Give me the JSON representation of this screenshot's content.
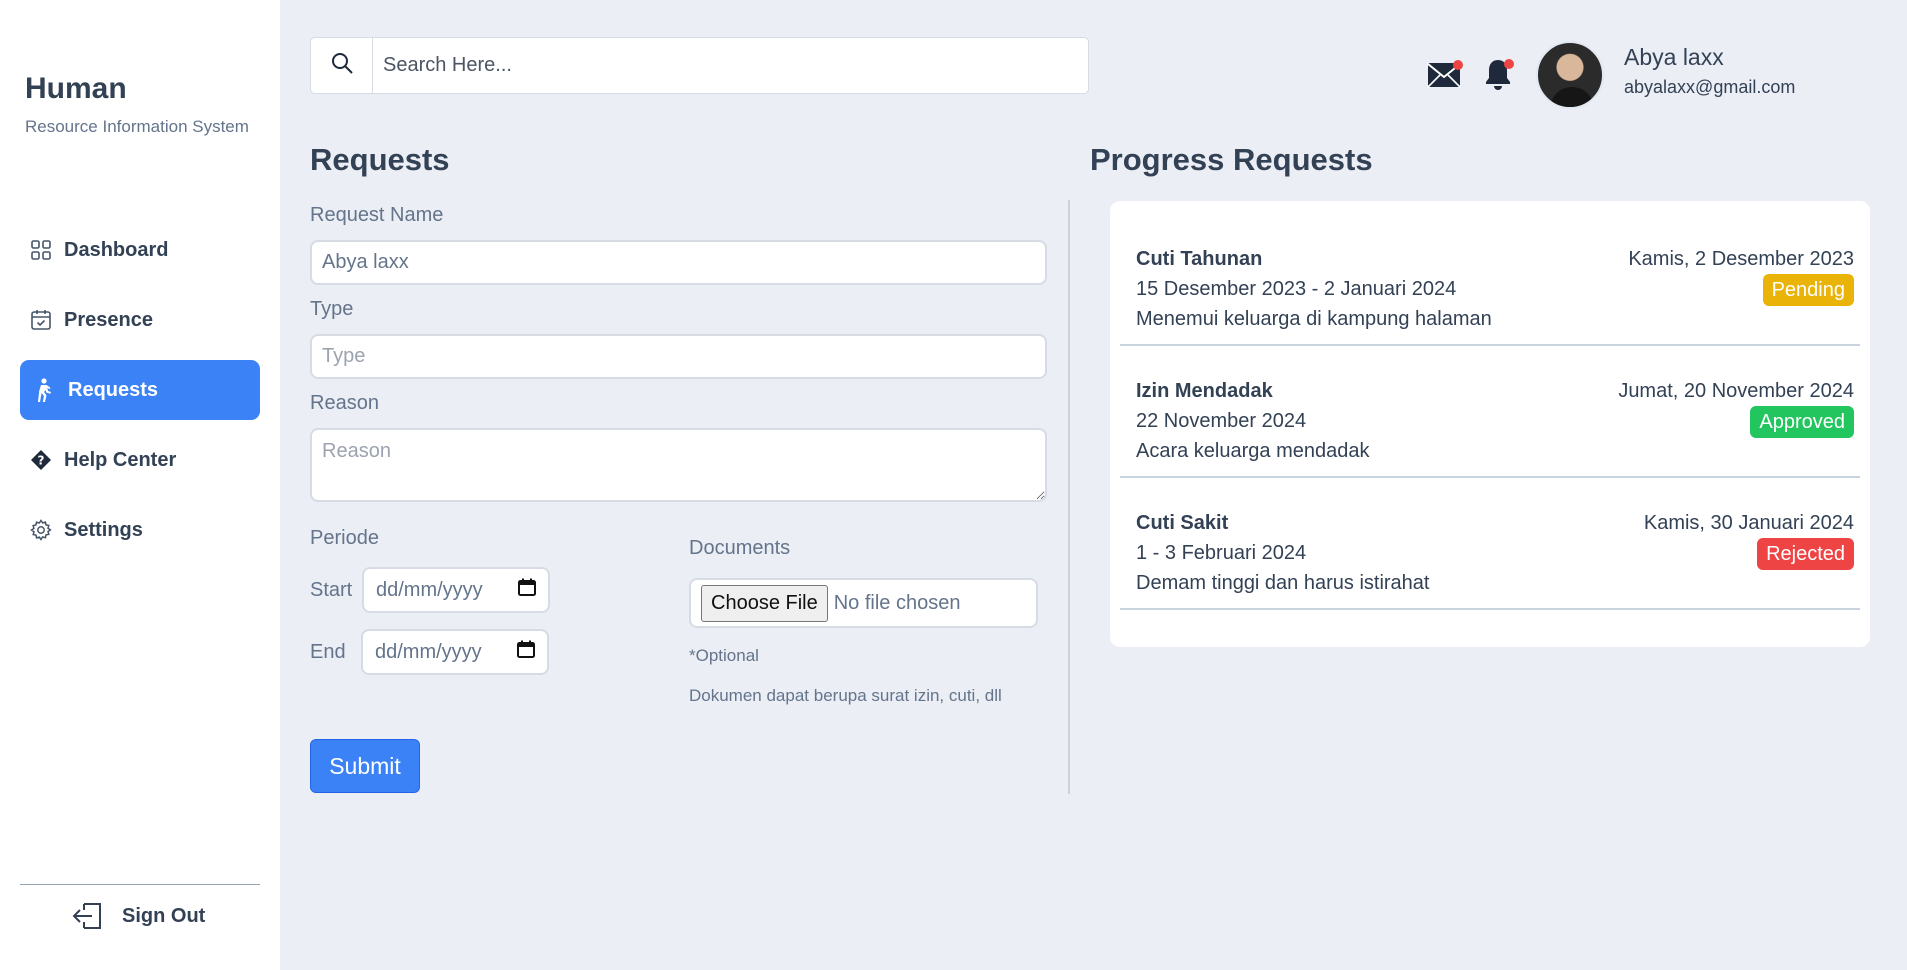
{
  "brand": {
    "title": "Human",
    "subtitle": "Resource Information System"
  },
  "sidebar": {
    "items": [
      {
        "label": "Dashboard",
        "icon": "grid-icon"
      },
      {
        "label": "Presence",
        "icon": "calendar-check-icon"
      },
      {
        "label": "Requests",
        "icon": "person-walking-icon",
        "active": true
      },
      {
        "label": "Help Center",
        "icon": "question-diamond-icon"
      },
      {
        "label": "Settings",
        "icon": "gear-icon"
      }
    ],
    "signout_label": "Sign Out"
  },
  "search": {
    "placeholder": "Search Here..."
  },
  "user": {
    "name": "Abya laxx",
    "email": "abyalaxx@gmail.com"
  },
  "colors": {
    "accent": "#3b82f6",
    "pending": "#eab308",
    "approved": "#22c55e",
    "rejected": "#ef4444",
    "background": "#ebeef5"
  },
  "requests_form": {
    "title": "Requests",
    "request_name_label": "Request Name",
    "request_name_value": "Abya laxx",
    "type_label": "Type",
    "type_placeholder": "Type",
    "reason_label": "Reason",
    "reason_placeholder": "Reason",
    "periode_label": "Periode",
    "start_label": "Start",
    "end_label": "End",
    "date_placeholder": "dd/mm/yyyy",
    "documents_label": "Documents",
    "choose_file_label": "Choose File",
    "no_file_label": "No file chosen",
    "optional_note": "*Optional",
    "documents_hint": "Dokumen dapat berupa surat izin, cuti, dll",
    "submit_label": "Submit"
  },
  "progress": {
    "title": "Progress Requests",
    "items": [
      {
        "name": "Cuti Tahunan",
        "date": "Kamis, 2 Desember 2023",
        "period": "15 Desember 2023 - 2 Januari 2024",
        "reason": "Menemui keluarga di kampung halaman",
        "status": "Pending"
      },
      {
        "name": "Izin Mendadak",
        "date": "Jumat, 20 November 2024",
        "period": "22 November 2024",
        "reason": "Acara keluarga mendadak",
        "status": "Approved"
      },
      {
        "name": "Cuti Sakit",
        "date": "Kamis, 30 Januari 2024",
        "period": "1 - 3 Februari 2024",
        "reason": "Demam tinggi dan harus istirahat",
        "status": "Rejected"
      }
    ]
  }
}
